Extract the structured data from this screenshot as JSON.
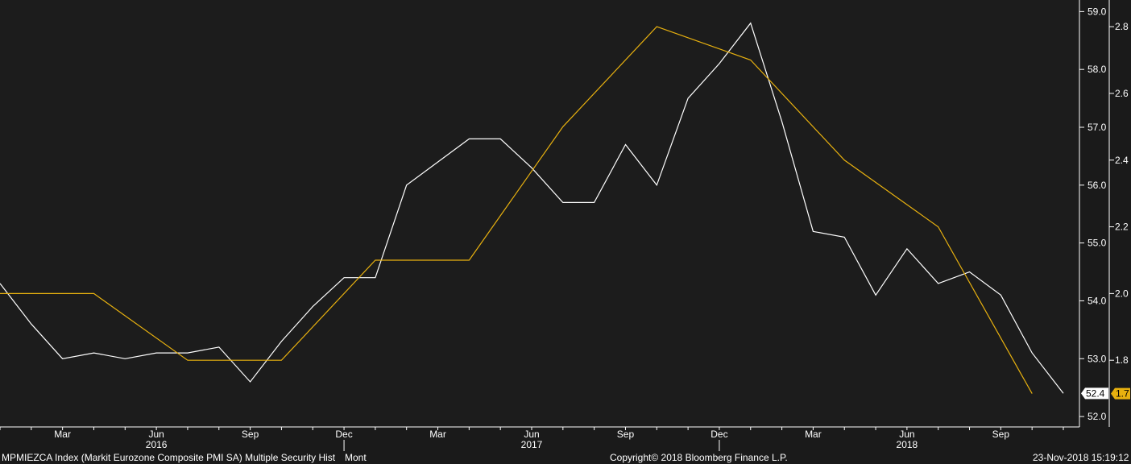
{
  "chart_data": {
    "type": "line",
    "title": "",
    "x_axis": {
      "month_labels": [
        {
          "label": "Mar",
          "month": "2016-03"
        },
        {
          "label": "Jun",
          "month": "2016-06"
        },
        {
          "label": "Sep",
          "month": "2016-09"
        },
        {
          "label": "Dec",
          "month": "2016-12"
        },
        {
          "label": "Mar",
          "month": "2017-03"
        },
        {
          "label": "Jun",
          "month": "2017-06"
        },
        {
          "label": "Sep",
          "month": "2017-09"
        },
        {
          "label": "Dec",
          "month": "2017-12"
        },
        {
          "label": "Mar",
          "month": "2018-03"
        },
        {
          "label": "Jun",
          "month": "2018-06"
        },
        {
          "label": "Sep",
          "month": "2018-09"
        }
      ],
      "year_labels": [
        {
          "label": "2016",
          "month": "2016-06"
        },
        {
          "label": "2017",
          "month": "2017-06"
        },
        {
          "label": "2018",
          "month": "2018-06"
        }
      ],
      "range": [
        "2016-01",
        "2018-11"
      ]
    },
    "y_axes": {
      "left_scale": {
        "ticks": [
          "59.0",
          "58.0",
          "57.0",
          "56.0",
          "55.0",
          "54.0",
          "53.0",
          "52.0"
        ],
        "range": [
          51.82,
          59.2
        ]
      },
      "right_scale": {
        "ticks": [
          "2.8",
          "2.6",
          "2.4",
          "2.2",
          "2.0",
          "1.8"
        ],
        "range": [
          1.6,
          2.88
        ]
      }
    },
    "series": [
      {
        "axis": "left_scale",
        "color": "#ffffff",
        "last_value_label": "52.4",
        "points": [
          [
            "2016-01",
            54.3
          ],
          [
            "2016-02",
            53.6
          ],
          [
            "2016-03",
            53.0
          ],
          [
            "2016-04",
            53.1
          ],
          [
            "2016-05",
            53.0
          ],
          [
            "2016-06",
            53.1
          ],
          [
            "2016-07",
            53.1
          ],
          [
            "2016-08",
            53.2
          ],
          [
            "2016-09",
            52.6
          ],
          [
            "2016-10",
            53.3
          ],
          [
            "2016-11",
            53.9
          ],
          [
            "2016-12",
            54.4
          ],
          [
            "2017-01",
            54.4
          ],
          [
            "2017-02",
            56.0
          ],
          [
            "2017-03",
            56.4
          ],
          [
            "2017-04",
            56.8
          ],
          [
            "2017-05",
            56.8
          ],
          [
            "2017-06",
            56.3
          ],
          [
            "2017-07",
            55.7
          ],
          [
            "2017-08",
            55.7
          ],
          [
            "2017-09",
            56.7
          ],
          [
            "2017-10",
            56.0
          ],
          [
            "2017-11",
            57.5
          ],
          [
            "2017-12",
            58.1
          ],
          [
            "2018-01",
            58.8
          ],
          [
            "2018-02",
            57.1
          ],
          [
            "2018-03",
            55.2
          ],
          [
            "2018-04",
            55.1
          ],
          [
            "2018-05",
            54.1
          ],
          [
            "2018-06",
            54.9
          ],
          [
            "2018-07",
            54.3
          ],
          [
            "2018-08",
            54.5
          ],
          [
            "2018-09",
            54.1
          ],
          [
            "2018-10",
            53.1
          ],
          [
            "2018-11",
            52.4
          ]
        ]
      },
      {
        "axis": "right_scale",
        "color": "#e8b10f",
        "last_value_label": "1.7",
        "points": [
          [
            "2016-01",
            2.0
          ],
          [
            "2016-04",
            2.0
          ],
          [
            "2016-07",
            1.8
          ],
          [
            "2016-10",
            1.8
          ],
          [
            "2017-01",
            2.1
          ],
          [
            "2017-04",
            2.1
          ],
          [
            "2017-07",
            2.5
          ],
          [
            "2017-10",
            2.8
          ],
          [
            "2018-01",
            2.7
          ],
          [
            "2018-04",
            2.4
          ],
          [
            "2018-07",
            2.2
          ],
          [
            "2018-10",
            1.7
          ]
        ]
      }
    ]
  },
  "footer": {
    "security": "MPMIEZCA Index (Markit Eurozone Composite PMI SA) Multiple Security Hist",
    "period": "Mont",
    "copyright": "Copyright© 2018 Bloomberg Finance L.P.",
    "timestamp": "23-Nov-2018 15:19:12"
  }
}
